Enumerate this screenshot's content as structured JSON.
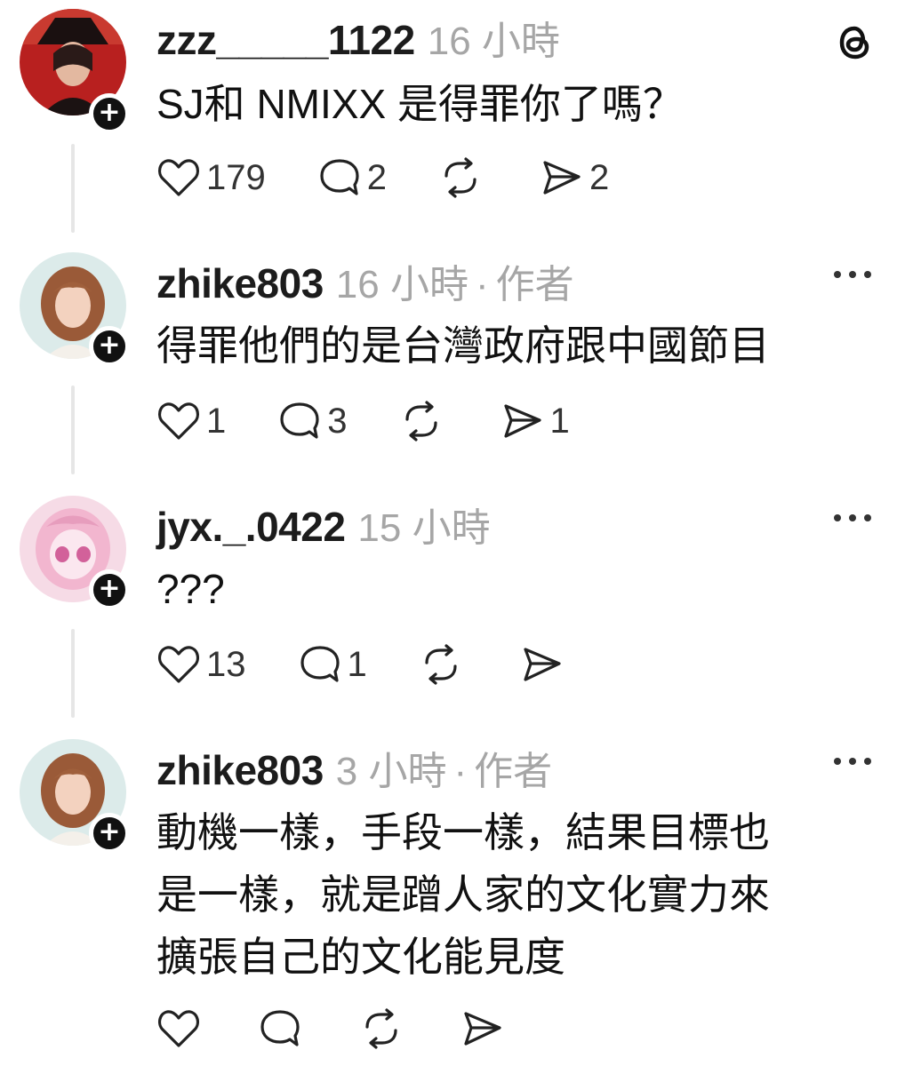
{
  "posts": [
    {
      "username": "zzz_____1122",
      "time": "16 小時",
      "is_author": false,
      "author_label": "",
      "lines": [
        "SJ和 NMIXX 是得罪你了嗎？"
      ],
      "likes": "179",
      "replies": "2",
      "reposts": "",
      "shares": "2"
    },
    {
      "username": "zhike803",
      "time": "16 小時",
      "is_author": true,
      "author_label": "作者",
      "lines": [
        "得罪他們的是台灣政府跟中國節目"
      ],
      "likes": "1",
      "replies": "3",
      "reposts": "",
      "shares": "1"
    },
    {
      "username": "jyx._.0422",
      "time": "15 小時",
      "is_author": false,
      "author_label": "",
      "lines": [
        "???"
      ],
      "likes": "13",
      "replies": "1",
      "reposts": "",
      "shares": ""
    },
    {
      "username": "zhike803",
      "time": "3 小時",
      "is_author": true,
      "author_label": "作者",
      "lines": [
        "動機一樣，手段一樣，結果目標也",
        "是一樣，就是蹭人家的文化實力來",
        "擴張自己的文化能見度"
      ],
      "likes": "",
      "replies": "",
      "reposts": "",
      "shares": ""
    }
  ],
  "separator": "·",
  "icons": {
    "app_logo": "threads-logo-icon",
    "more": "more-options-icon",
    "like": "heart-icon",
    "reply": "comment-icon",
    "repost": "repost-icon",
    "share": "share-icon",
    "follow": "plus-icon"
  },
  "colors": {
    "text": "#111111",
    "muted": "#a6a6a6",
    "badge": "#111111",
    "thread_line": "#e6e6e6"
  }
}
